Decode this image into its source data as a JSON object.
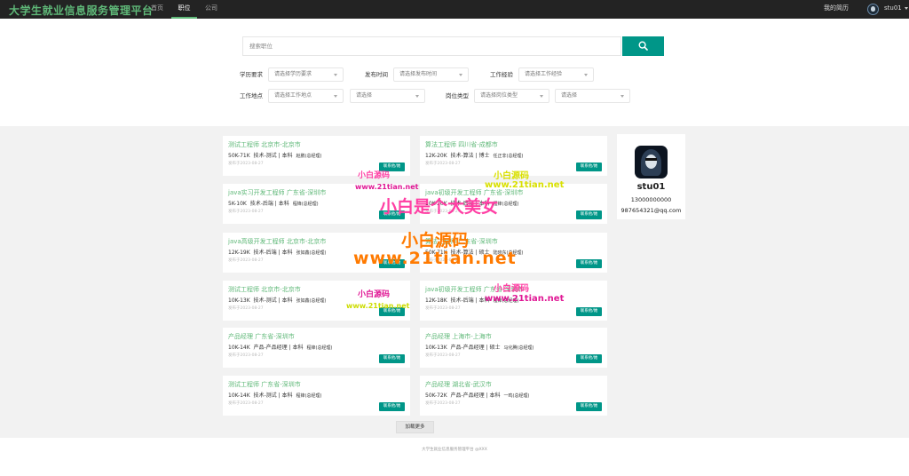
{
  "app": {
    "brand": "大学生就业信息服务管理平台",
    "nav": [
      {
        "label": "首页",
        "active": false
      },
      {
        "label": "职位",
        "active": true
      },
      {
        "label": "公司",
        "active": false
      }
    ],
    "my_resume": "我的简历",
    "username": "stu01"
  },
  "search": {
    "placeholder": "搜索职位",
    "button_icon": "search-icon"
  },
  "filters": {
    "education": {
      "label": "学历要求",
      "placeholder": "请选择学历要求"
    },
    "publish_time": {
      "label": "发布时间",
      "placeholder": "请选择发布时间"
    },
    "experience": {
      "label": "工作经验",
      "placeholder": "请选择工作经验"
    },
    "location": {
      "label": "工作地点",
      "placeholder": "请选择工作地点",
      "sub_placeholder": "请选择"
    },
    "job_type": {
      "label": "岗位类型",
      "placeholder": "请选择岗位类型",
      "sub_placeholder": "请选择"
    }
  },
  "contact_label": "联系他/她",
  "jobs": [
    {
      "title": "测试工程师  北京市-北京市",
      "salary": "50K-71K",
      "category": "技术-测试",
      "education": "本科",
      "contact": "赵鹏(总经理)",
      "date": "发布于2023-08-27"
    },
    {
      "title": "算法工程师  四川省-成都市",
      "salary": "12K-20K",
      "category": "技术-算法",
      "education": "博士",
      "contact": "任正非(总经理)",
      "date": "发布于2023-08-27"
    },
    {
      "title": "java实习开发工程师  广东省-深圳市",
      "salary": "5K-10K",
      "category": "技术-后端",
      "education": "本科",
      "contact": "程锋(总经理)",
      "date": "发布于2023-08-27"
    },
    {
      "title": "java初级开发工程师  广东省-深圳市",
      "salary": "10K-20K",
      "category": "技术-后端",
      "education": "本科",
      "contact": "程锋(总经理)",
      "date": "发布于2023-08-27"
    },
    {
      "title": "java高级开发工程师  北京市-北京市",
      "salary": "12K-19K",
      "category": "技术-后端",
      "education": "本科",
      "contact": "张如鑫(总经理)",
      "date": "发布于2023-08-27"
    },
    {
      "title": "算法工程师  广东省-深圳市",
      "salary": "50K-71K",
      "category": "技术-算法",
      "education": "硕士",
      "contact": "陆晓东(总经理)",
      "date": "发布于2023-08-27"
    },
    {
      "title": "测试工程师  北京市-北京市",
      "salary": "10K-13K",
      "category": "技术-测试",
      "education": "本科",
      "contact": "张如鑫(总经理)",
      "date": "发布于2023-08-27"
    },
    {
      "title": "java初级开发工程师  广东省-深圳市",
      "salary": "12K-18K",
      "category": "技术-后端",
      "education": "本科",
      "contact": "程锋(总经理)",
      "date": "发布于2023-08-27"
    },
    {
      "title": "产品经理  广东省-深圳市",
      "salary": "10K-14K",
      "category": "产品-产品经理",
      "education": "本科",
      "contact": "程锋(总经理)",
      "date": "发布于2023-08-27"
    },
    {
      "title": "产品经理  上海市-上海市",
      "salary": "10K-13K",
      "category": "产品-产品经理",
      "education": "硕士",
      "contact": "马化腾(总经理)",
      "date": "发布于2023-08-27"
    },
    {
      "title": "测试工程师  广东省-深圳市",
      "salary": "10K-14K",
      "category": "技术-测试",
      "education": "本科",
      "contact": "程锋(总经理)",
      "date": "发布于2023-08-27"
    },
    {
      "title": "产品经理  湖北省-武汉市",
      "salary": "50K-72K",
      "category": "产品-产品经理",
      "education": "本科",
      "contact": "一鸣(总经理)",
      "date": "发布于2023-08-27"
    }
  ],
  "profile": {
    "username": "stu01",
    "phone": "13000000000",
    "email": "987654321@qq.com"
  },
  "load_more": "加载更多",
  "footer": "大学生就业信息服务管理平台 @XXX",
  "watermarks": {
    "small_name": "小白源码",
    "site": "www.21tian.net",
    "slogan": "小白是个大美女"
  },
  "colors": {
    "accent": "#009688",
    "brand_green": "#5fb878",
    "nav_bg": "#232323"
  }
}
